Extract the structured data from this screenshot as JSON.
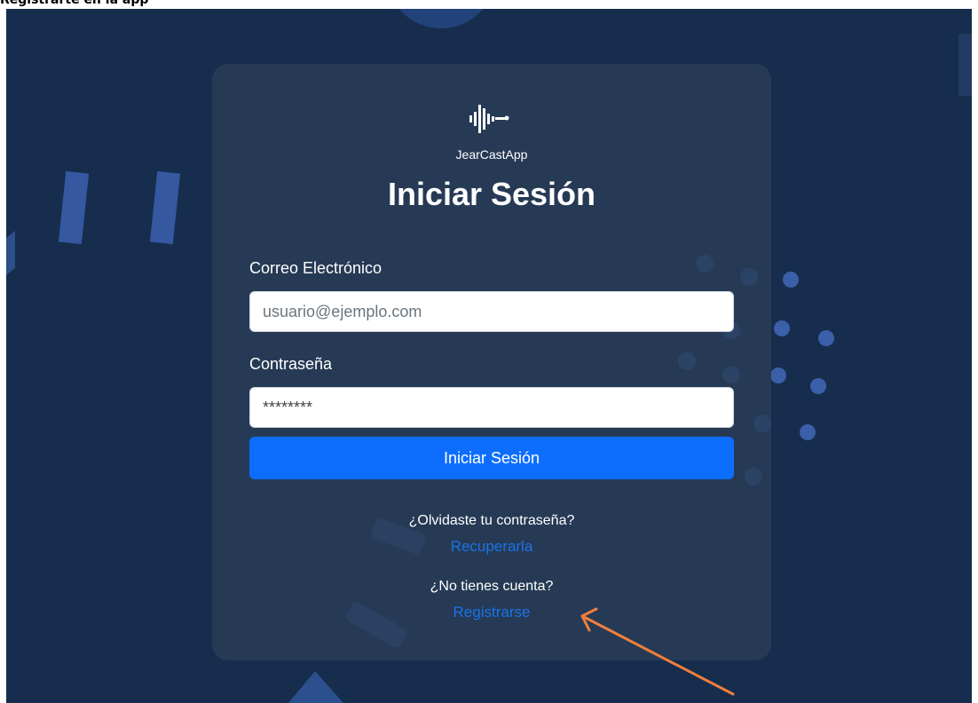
{
  "document": {
    "heading": "Registrarte en la app"
  },
  "app": {
    "name": "JearCastApp"
  },
  "login": {
    "title": "Iniciar Sesión",
    "email_label": "Correo Electrónico",
    "email_value": "usuario@ejemplo.com",
    "password_label": "Contraseña",
    "password_value": "********",
    "submit_label": "Iniciar Sesión",
    "forgot_question": "¿Olvidaste tu contraseña?",
    "forgot_link": "Recuperarla",
    "no_account_question": "¿No tienes cuenta?",
    "register_link": "Registrarse"
  },
  "icons": {
    "logo": "soundwave-logo-icon",
    "annotation": "arrow-annotation"
  },
  "colors": {
    "background": "#162d4d",
    "card": "#263a55",
    "primary_button": "#0d6efd",
    "link": "#1a73e8",
    "annotation_arrow": "#f07f3c"
  }
}
